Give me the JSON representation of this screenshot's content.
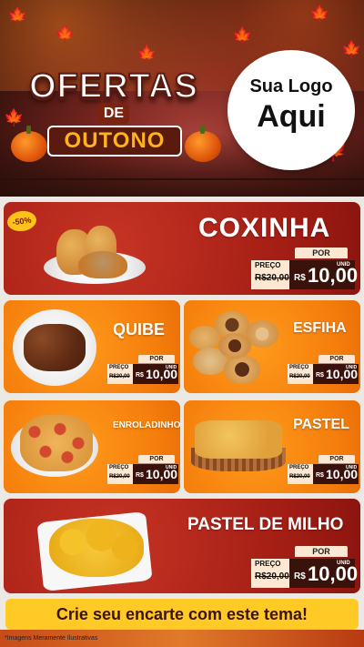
{
  "hero": {
    "title_line1": "OFERTAS",
    "title_line2": "DE",
    "title_line3": "OUTONO",
    "logo_line1": "Sua Logo",
    "logo_line2": "Aqui"
  },
  "colors": {
    "red_card": "#a21d14",
    "orange_card": "#f57e0c",
    "price_dark": "#3a120c",
    "price_light": "#fce7d2",
    "banner": "#ffc926"
  },
  "badge": "-50%",
  "products": {
    "coxinha": {
      "name": "COXINHA",
      "por": "POR",
      "preco": "PREÇO",
      "old": "R$20,00",
      "rs": "R$",
      "value": "10,00",
      "unid": "UNID"
    },
    "quibe": {
      "name": "QUIBE",
      "por": "POR",
      "preco": "PREÇO",
      "old": "R$20,00",
      "rs": "R$",
      "value": "10,00",
      "unid": "UNID"
    },
    "esfiha": {
      "name": "ESFIHA",
      "por": "POR",
      "preco": "PREÇO",
      "old": "R$20,00",
      "rs": "R$",
      "value": "10,00",
      "unid": "UNID"
    },
    "enroladinho": {
      "name": "ENROLADINHO",
      "por": "POR",
      "preco": "PREÇO",
      "old": "R$20,00",
      "rs": "R$",
      "value": "10,00",
      "unid": "UNID"
    },
    "pastel": {
      "name": "PASTEL",
      "por": "POR",
      "preco": "PREÇO",
      "old": "R$20,00",
      "rs": "R$",
      "value": "10,00",
      "unid": "UNID"
    },
    "pastel_milho": {
      "name": "PASTEL DE MILHO",
      "por": "POR",
      "preco": "PREÇO",
      "old": "R$20,00",
      "rs": "R$",
      "value": "10,00",
      "unid": "UNID"
    }
  },
  "banner": "Crie seu encarte com este tema!",
  "footnote": "*Imagens Meramente Ilustrativas"
}
